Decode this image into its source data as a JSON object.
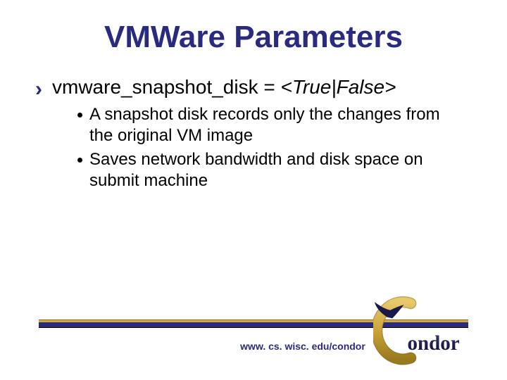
{
  "title": "VMWare Parameters",
  "main_bullet": {
    "prefix": "vmware_snapshot_disk = ",
    "value": "<True|False>"
  },
  "sub_bullets": [
    "A snapshot disk records only the changes from the original VM image",
    "Saves network bandwidth and disk space on submit machine"
  ],
  "footer_url": "www. cs. wisc. edu/condor",
  "logo_text": "Condor",
  "colors": {
    "title_blue": "#2a2a80",
    "bar_gold": "#d4a94a",
    "bar_blue": "#2a2a80",
    "logo_gold": "#c9a43a",
    "logo_dark": "#1a1a4a"
  }
}
